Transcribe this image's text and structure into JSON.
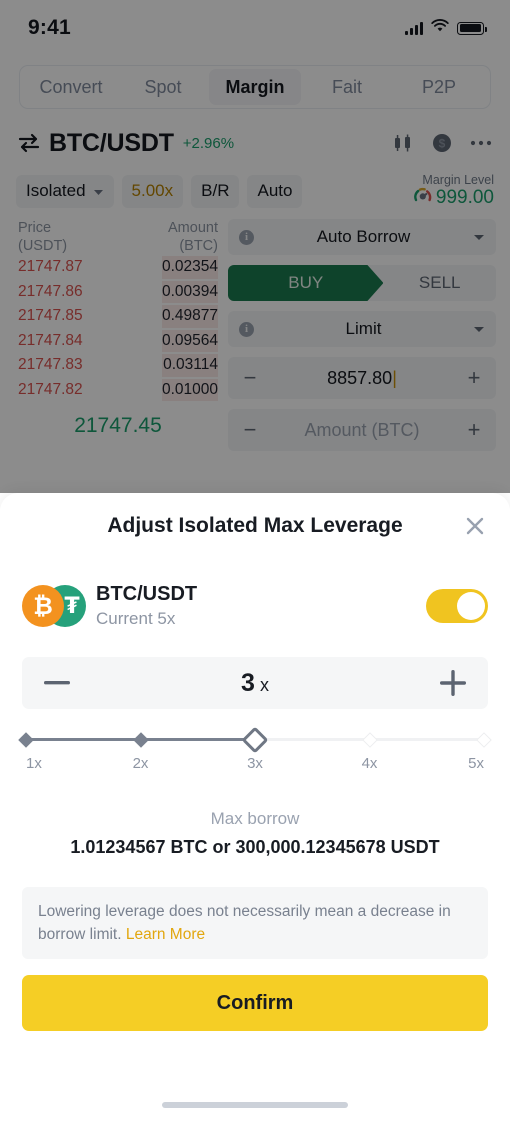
{
  "status_bar": {
    "time": "9:41"
  },
  "top_tabs": [
    {
      "label": "Convert",
      "active": false
    },
    {
      "label": "Spot",
      "active": false
    },
    {
      "label": "Margin",
      "active": true
    },
    {
      "label": "Fait",
      "active": false
    },
    {
      "label": "P2P",
      "active": false
    }
  ],
  "pair_header": {
    "symbol": "BTC/USDT",
    "change": "+2.96%",
    "change_color": "#1a9e6c"
  },
  "controls": {
    "mode": "Isolated",
    "leverage": "5.00x",
    "leverage_color": "#b58100",
    "br": "B/R",
    "auto": "Auto",
    "margin_level_label": "Margin Level",
    "margin_level_value": "999.00"
  },
  "orderbook": {
    "col_price": "Price\n(USDT)",
    "col_price_line1": "Price",
    "col_price_line2": "(USDT)",
    "col_amount_line1": "Amount",
    "col_amount_line2": "(BTC)",
    "asks": [
      {
        "price": "21747.87",
        "amount": "0.02354",
        "depth": 28
      },
      {
        "price": "21747.86",
        "amount": "0.00394",
        "depth": 28
      },
      {
        "price": "21747.85",
        "amount": "0.49877",
        "depth": 28
      },
      {
        "price": "21747.84",
        "amount": "0.09564",
        "depth": 28
      },
      {
        "price": "21747.83",
        "amount": "0.03114",
        "depth": 28
      },
      {
        "price": "21747.82",
        "amount": "0.01000",
        "depth": 28
      }
    ],
    "last_price": "21747.45"
  },
  "order_form": {
    "borrow_mode": "Auto Borrow",
    "buy_label": "BUY",
    "sell_label": "SELL",
    "order_type": "Limit",
    "price_value": "8857.80",
    "amount_placeholder": "Amount (BTC)"
  },
  "modal": {
    "title": "Adjust Isolated Max Leverage",
    "pair_symbol": "BTC/USDT",
    "current_label": "Current 5x",
    "toggle_on": true,
    "toggle_color": "#f0c420",
    "stepper_value": "3",
    "stepper_unit": "x",
    "slider": {
      "value": 3,
      "min": 1,
      "max": 5,
      "ticks": [
        "1x",
        "2x",
        "3x",
        "4x",
        "5x"
      ]
    },
    "max_borrow_label": "Max borrow",
    "max_borrow_value": "1.01234567 BTC or 300,000.12345678 USDT",
    "notice_text": "Lowering leverage does not necessarily mean a decrease in borrow limit.",
    "notice_link": "Learn More",
    "notice_link_color": "#e2a70f",
    "confirm_label": "Confirm",
    "confirm_color": "#f5ce25"
  }
}
